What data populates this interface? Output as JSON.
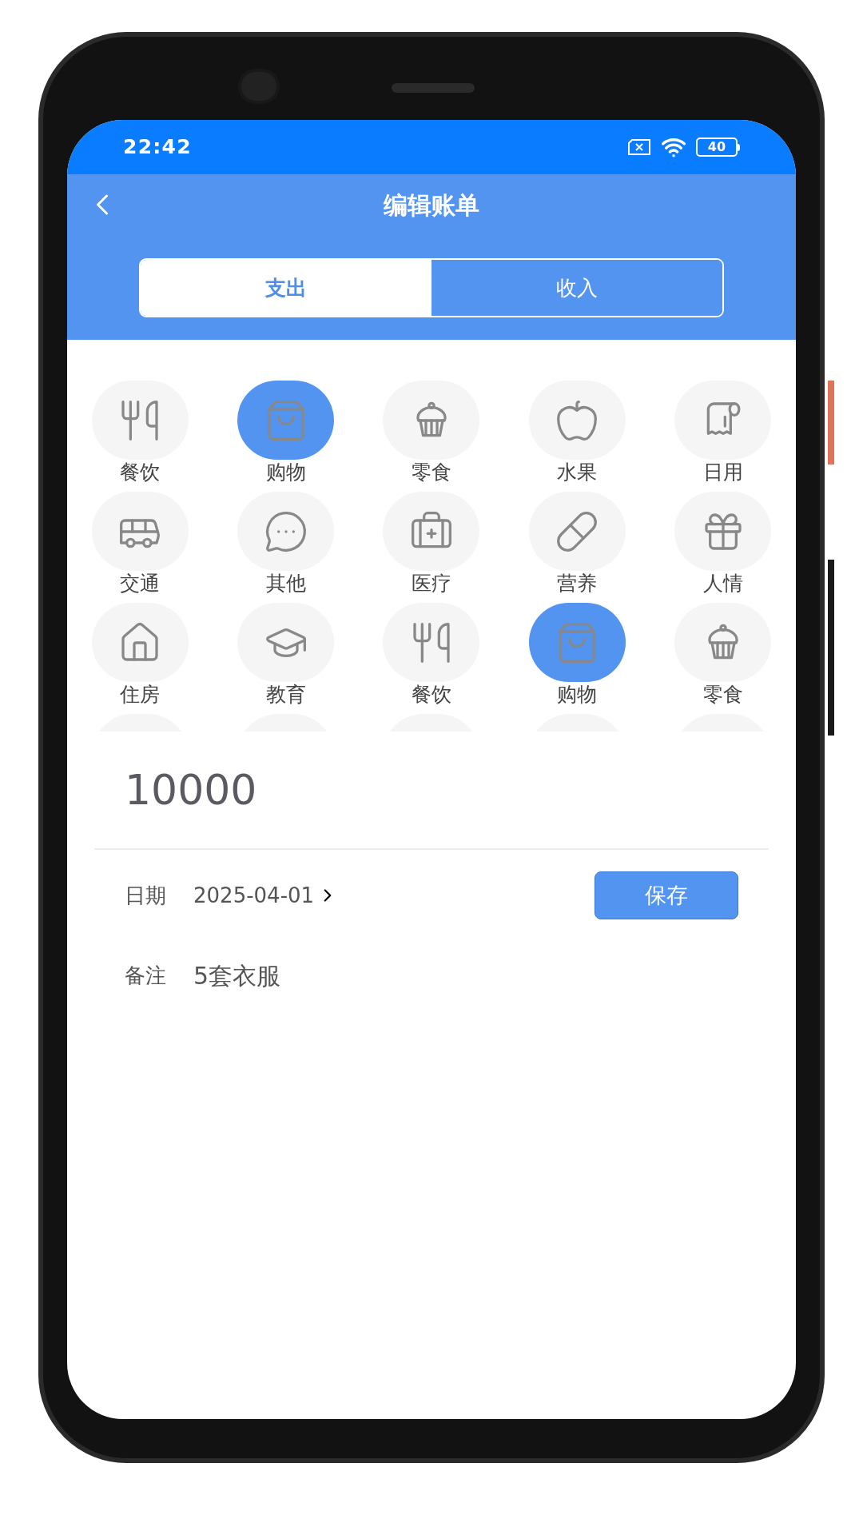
{
  "status_bar": {
    "time": "22:42",
    "battery": "40"
  },
  "header": {
    "title": "编辑账单"
  },
  "tabs": [
    {
      "label": "支出",
      "selected": true
    },
    {
      "label": "收入",
      "selected": false
    }
  ],
  "categories": [
    {
      "label": "餐饮",
      "kind": "utensils",
      "selected": false
    },
    {
      "label": "购物",
      "kind": "bag",
      "selected": true
    },
    {
      "label": "零食",
      "kind": "cake",
      "selected": false
    },
    {
      "label": "水果",
      "kind": "apple",
      "selected": false
    },
    {
      "label": "日用",
      "kind": "roll",
      "selected": false
    },
    {
      "label": "交通",
      "kind": "bus",
      "selected": false
    },
    {
      "label": "其他",
      "kind": "more",
      "selected": false
    },
    {
      "label": "医疗",
      "kind": "medkit",
      "selected": false
    },
    {
      "label": "营养",
      "kind": "pill",
      "selected": false
    },
    {
      "label": "人情",
      "kind": "gift",
      "selected": false
    },
    {
      "label": "住房",
      "kind": "house",
      "selected": false
    },
    {
      "label": "教育",
      "kind": "cap",
      "selected": false
    },
    {
      "label": "餐饮",
      "kind": "utensils",
      "selected": false
    },
    {
      "label": "购物",
      "kind": "bag",
      "selected": true
    },
    {
      "label": "零食",
      "kind": "cake",
      "selected": false
    }
  ],
  "amount": {
    "value": "10000"
  },
  "date": {
    "label": "日期",
    "value": "2025-04-01"
  },
  "save_button": "保存",
  "note": {
    "label": "备注",
    "value": "5套衣服"
  }
}
